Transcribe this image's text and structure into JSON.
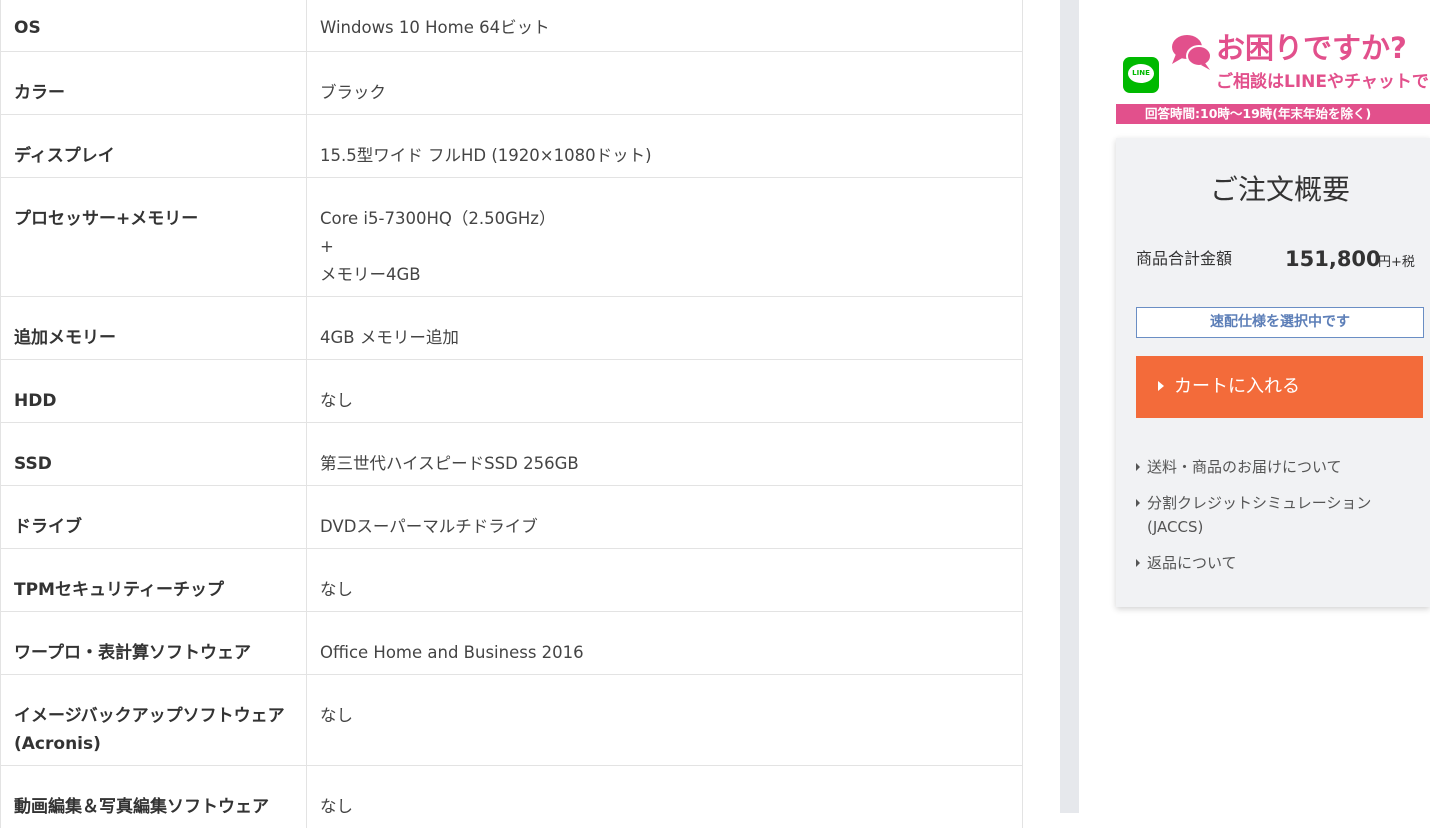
{
  "spec_rows": [
    {
      "label": "OS",
      "value": [
        "Windows 10 Home 64ビット"
      ]
    },
    {
      "label": "カラー",
      "value": [
        "ブラック"
      ]
    },
    {
      "label": "ディスプレイ",
      "value": [
        "15.5型ワイド フルHD (1920×1080ドット)"
      ]
    },
    {
      "label": "プロセッサー+メモリー",
      "value": [
        "Core i5-7300HQ（2.50GHz）",
        "+",
        "メモリー4GB"
      ]
    },
    {
      "label": "追加メモリー",
      "value": [
        "4GB メモリー追加"
      ]
    },
    {
      "label": "HDD",
      "value": [
        "なし"
      ]
    },
    {
      "label": "SSD",
      "value": [
        "第三世代ハイスピードSSD 256GB"
      ]
    },
    {
      "label": "ドライブ",
      "value": [
        "DVDスーパーマルチドライブ"
      ]
    },
    {
      "label": "TPMセキュリティーチップ",
      "value": [
        "なし"
      ]
    },
    {
      "label": "ワープロ・表計算ソフトウェア",
      "value": [
        "Office Home and Business 2016"
      ]
    },
    {
      "label": "イメージバックアップソフトウェア(Acronis)",
      "value": [
        "なし"
      ]
    },
    {
      "label": "動画編集＆写真編集ソフトウェア",
      "value": [
        "なし"
      ]
    }
  ],
  "banner": {
    "line_logo_text": "LINE",
    "headline": "お困りですか?",
    "subline": "ご相談はLINEやチャットで",
    "hours": "回答時間:10時～19時(年末年始を除く)"
  },
  "order": {
    "title": "ご注文概要",
    "total_label": "商品合計金額",
    "total_value": "151,800",
    "total_unit": "円+税",
    "express_label": "速配仕様を選択中です",
    "cart_label": "カートに入れる",
    "links": [
      "送料・商品のお届けについて",
      "分割クレジットシミュレーション(JACCS)",
      "返品について"
    ]
  },
  "colors": {
    "accent_pink": "#e2508c",
    "cart_orange": "#f36b3a",
    "express_blue": "#5d7fb8",
    "line_green": "#00b900"
  }
}
